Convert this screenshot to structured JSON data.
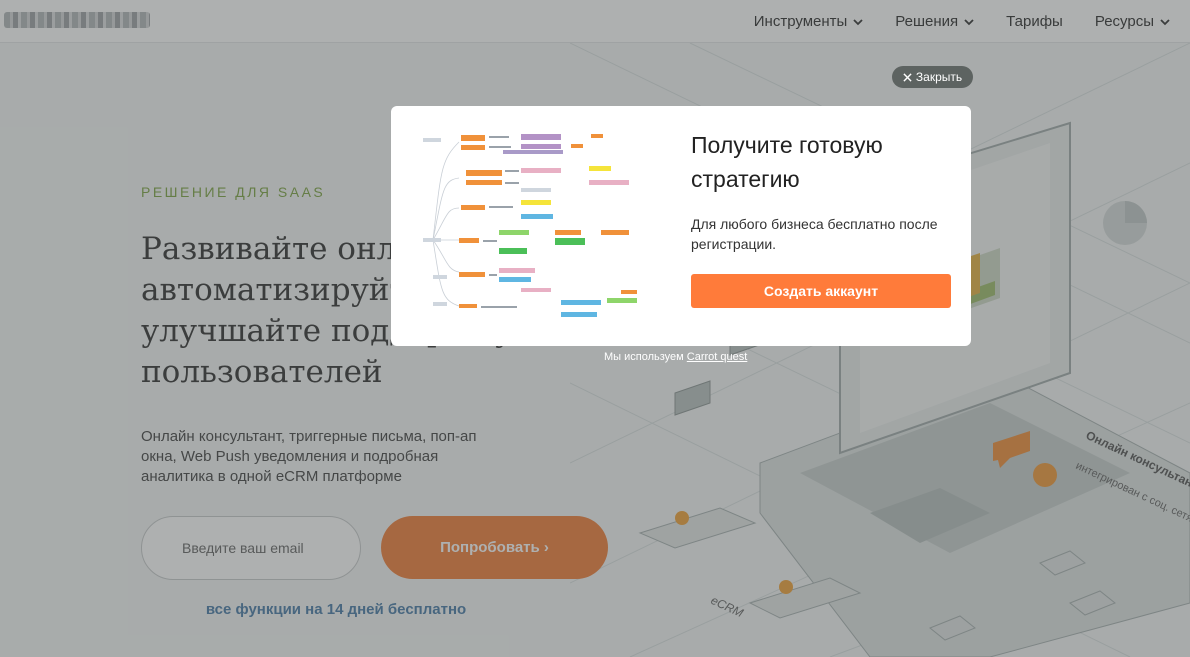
{
  "header": {
    "nav": [
      {
        "label": "Инструменты",
        "has_dropdown": true
      },
      {
        "label": "Решения",
        "has_dropdown": true
      },
      {
        "label": "Тарифы",
        "has_dropdown": false
      },
      {
        "label": "Ресурсы",
        "has_dropdown": true
      }
    ]
  },
  "hero": {
    "eyebrow": "РЕШЕНИЕ ДЛЯ SAAS",
    "headline": "Развивайте онлайн бизнес, автоматизируйте воронку и улучшайте поддержку пользователей",
    "subtext": "Онлайн консультант, триггерные письма, поп-ап окна, Web Push уведомления и подробная аналитика в одной eCRM платформе",
    "email_placeholder": "Введите ваш email",
    "try_button": "Попробовать ›",
    "trial_note": "все функции на 14 дней бесплатно",
    "illustration_labels": {
      "consultant": "Онлайн консультант",
      "integrated": "интегрирован с соц. сетями",
      "ecrm": "eCRM"
    }
  },
  "popup": {
    "close_label": "Закрыть",
    "title": "Получите готовую стратегию",
    "text": "Для любого бизнеса бесплатно после регистрации.",
    "button": "Создать аккаунт",
    "powered_prefix": "Мы используем",
    "powered_link": "Carrot quest"
  },
  "colors": {
    "accent_orange": "#ff7b3a",
    "eyebrow_green": "#7ea542",
    "note_blue": "#4a7ca8",
    "overlay": "rgba(70,76,74,0.44)"
  }
}
